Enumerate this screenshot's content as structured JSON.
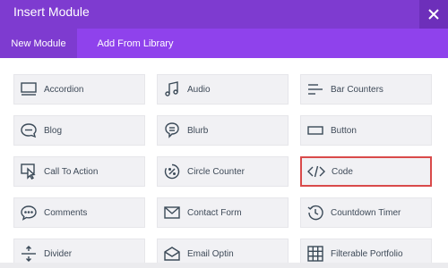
{
  "header": {
    "title": "Insert Module"
  },
  "tabs": [
    {
      "label": "New Module"
    },
    {
      "label": "Add From Library"
    }
  ],
  "modules": [
    {
      "label": "Accordion",
      "icon": "accordion-icon"
    },
    {
      "label": "Audio",
      "icon": "audio-icon"
    },
    {
      "label": "Bar Counters",
      "icon": "bar-counters-icon"
    },
    {
      "label": "Blog",
      "icon": "blog-icon"
    },
    {
      "label": "Blurb",
      "icon": "blurb-icon"
    },
    {
      "label": "Button",
      "icon": "button-icon"
    },
    {
      "label": "Call To Action",
      "icon": "call-to-action-icon"
    },
    {
      "label": "Circle Counter",
      "icon": "circle-counter-icon"
    },
    {
      "label": "Code",
      "icon": "code-icon"
    },
    {
      "label": "Comments",
      "icon": "comments-icon"
    },
    {
      "label": "Contact Form",
      "icon": "contact-form-icon"
    },
    {
      "label": "Countdown Timer",
      "icon": "countdown-timer-icon"
    },
    {
      "label": "Divider",
      "icon": "divider-icon"
    },
    {
      "label": "Email Optin",
      "icon": "email-optin-icon"
    },
    {
      "label": "Filterable Portfolio",
      "icon": "filterable-portfolio-icon"
    }
  ],
  "colors": {
    "header": "#7e3bd0",
    "tabs": "#8f42ec",
    "selected_border": "#d94a4a"
  }
}
